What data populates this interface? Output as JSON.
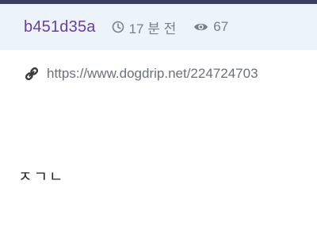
{
  "post": {
    "author": "b451d35a",
    "time_ago": "17 분 전",
    "views": "67",
    "link": "https://www.dogdrip.net/224724703",
    "content": "ㅈㄱㄴ"
  },
  "icons": {
    "time": "clock-icon",
    "views": "eye-icon",
    "link": "link-icon"
  },
  "colors": {
    "meta_background": "#edf3fb",
    "author": "#6a3ea0",
    "meta_text": "#7a7f87",
    "top_border": "#3a3d5c"
  }
}
